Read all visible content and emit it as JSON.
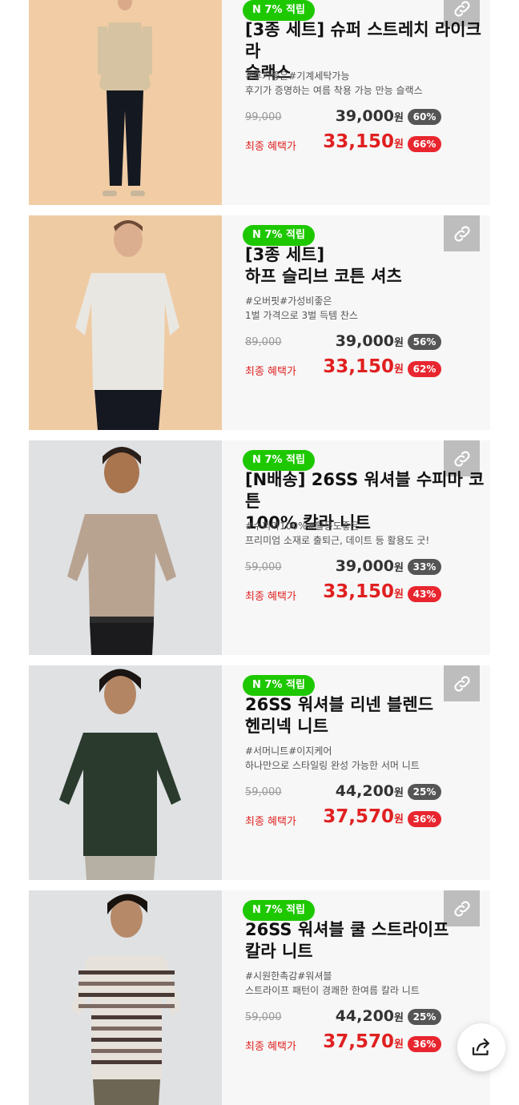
{
  "products": [
    {
      "badge": "N 7% 적립",
      "title": "[3종 세트] 슈퍼 스트레치 라이크라\n슬랙스",
      "tags": "#후기좋은#기계세탁가능",
      "desc": "후기가 증명하는 여름 착용 가능 만능 슬랙스",
      "original_price": "99,000",
      "price": "39,000",
      "discount": "60%",
      "final_label": "최종 혜택가",
      "final_price": "33,150",
      "final_discount": "66%",
      "won": "원",
      "image": "man-beige-shirt-black-pants"
    },
    {
      "badge": "N 7% 적립",
      "title": "[3종 세트]\n하프 슬리브 코튼 셔츠",
      "tags": "#오버핏#가성비좋은",
      "desc": "1벌 가격으로 3벌 득템 찬스",
      "original_price": "89,000",
      "price": "39,000",
      "discount": "56%",
      "final_label": "최종 혜택가",
      "final_price": "33,150",
      "final_discount": "62%",
      "won": "원",
      "image": "man-white-short-sleeve-shirt"
    },
    {
      "badge": "N 7% 적립",
      "title": "[N배송] 26SS 워셔블 수피마 코튼\n100% 칼라 니트",
      "tags": "#수피마100%#활용도좋은",
      "desc": "프리미엄 소재로 출퇴근, 데이트 등 활용도 굿!",
      "original_price": "59,000",
      "price": "39,000",
      "discount": "33%",
      "final_label": "최종 혜택가",
      "final_price": "33,150",
      "final_discount": "43%",
      "won": "원",
      "image": "man-beige-polo-knit"
    },
    {
      "badge": "N 7% 적립",
      "title": "26SS 워셔블 리넨 블렌드\n헨리넥 니트",
      "tags": "#서머니트#이지케어",
      "desc": "하나만으로 스타일링 완성 가능한 서머 니트",
      "original_price": "59,000",
      "price": "44,200",
      "discount": "25%",
      "final_label": "최종 혜택가",
      "final_price": "37,570",
      "final_discount": "36%",
      "won": "원",
      "image": "man-green-henley-knit"
    },
    {
      "badge": "N 7% 적립",
      "title": "26SS 워셔블 쿨 스트라이프\n칼라 니트",
      "tags": "#시원한촉감#워셔블",
      "desc": "스트라이프 패턴이 경쾌한 한여름 칼라 니트",
      "original_price": "59,000",
      "price": "44,200",
      "discount": "25%",
      "final_label": "최종 혜택가",
      "final_price": "37,570",
      "final_discount": "36%",
      "won": "원",
      "image": "man-striped-collar-knit"
    }
  ],
  "icons": {
    "link": "link-icon",
    "share": "share-icon"
  },
  "colors": {
    "badge_green": "#1ec800",
    "sale_red": "#e02020",
    "card_bg": "#f7f7f7"
  }
}
